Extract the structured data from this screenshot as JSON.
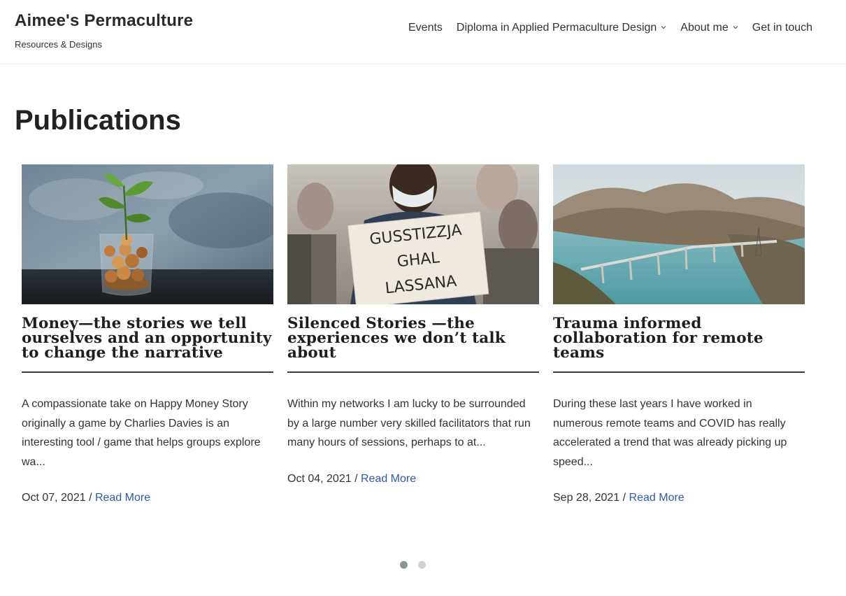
{
  "site": {
    "title": "Aimee's Permaculture",
    "tagline": "Resources & Designs"
  },
  "nav": {
    "items": [
      {
        "label": "Events",
        "has_dropdown": false
      },
      {
        "label": "Diploma in Applied Permaculture Design",
        "has_dropdown": true
      },
      {
        "label": "About me",
        "has_dropdown": true
      },
      {
        "label": "Get in touch",
        "has_dropdown": false
      }
    ],
    "dropdown_icon": "chevron-down-icon"
  },
  "page": {
    "title": "Publications"
  },
  "posts": [
    {
      "image": "money-jar-plant-image",
      "title": "Money—the stories we tell ourselves and an opportunity to change the narrative",
      "excerpt": "A compassionate take on Happy Money Story originally a game by Charlies Davies is an interesting tool / game that helps groups explore wa...",
      "date": "Oct 07, 2021",
      "separator": "/",
      "read_more": "Read More"
    },
    {
      "image": "protest-sign-image",
      "sign_text": [
        "GUSSTIZZJA",
        "GHAL",
        "LASSANA"
      ],
      "title": "Silenced Stories —the experiences we don’t talk about",
      "excerpt": "Within my networks I am lucky to be surrounded by a large number very skilled facilitators that run many hours of sessions, perhaps to at...",
      "date": "Oct 04, 2021",
      "separator": "/",
      "read_more": "Read More"
    },
    {
      "image": "reservoir-bridge-image",
      "title": "Trauma informed collaboration for remote teams",
      "excerpt": "During these last years I have worked in numerous remote teams and COVID has really accelerated a trend that was already picking up speed...",
      "date": "Sep 28, 2021",
      "separator": "/",
      "read_more": "Read More"
    }
  ],
  "slider": {
    "total_pages": 2,
    "current_page": 1
  },
  "colors": {
    "link": "#2f5aa8",
    "text": "#333333",
    "dot_active": "#8a9691",
    "dot_inactive": "#cfd4d2"
  }
}
